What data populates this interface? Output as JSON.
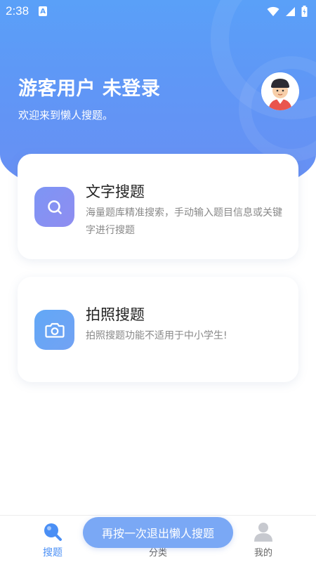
{
  "status_bar": {
    "time": "2:38",
    "indicator": "A"
  },
  "header": {
    "user_title": "游客用户 未登录",
    "welcome": "欢迎来到懒人搜题。",
    "colors": {
      "gradient_top": "#5aa0f8",
      "gradient_bottom": "#6a8ef3"
    }
  },
  "cards": [
    {
      "title": "文字搜题",
      "description": "海量题库精准搜索，手动输入题目信息或关键字进行搜题",
      "icon": "search-icon"
    },
    {
      "title": "拍照搜题",
      "description": "拍照搜题功能不适用于中小学生!",
      "icon": "camera-icon"
    }
  ],
  "tabbar": {
    "items": [
      {
        "label": "搜题",
        "icon": "search-tab-icon",
        "active": true
      },
      {
        "label": "分类",
        "icon": "category-tab-icon",
        "active": false
      },
      {
        "label": "我的",
        "icon": "profile-tab-icon",
        "active": false
      }
    ],
    "active_color": "#4a8ff5"
  },
  "toast": {
    "text": "再按一次退出懒人搜题"
  }
}
